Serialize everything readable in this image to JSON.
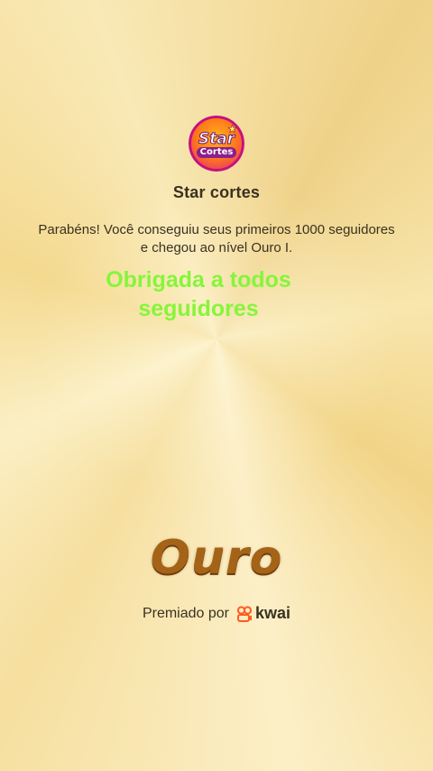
{
  "channel": {
    "logo_line1": "Star",
    "logo_line2": "Cortes",
    "name": "Star cortes"
  },
  "message": "Parabéns! Você conseguiu seus primeiros 1000 seguidores e chegou ao nível Ouro I.",
  "overlay_caption": "Obrigada a todos seguidores",
  "level": "Ouro",
  "award": {
    "label": "Premiado por",
    "brand": "kwai",
    "brand_icon": "kwai-logo-icon"
  },
  "colors": {
    "caption": "#86f53a",
    "level": "#a56318",
    "brand": "#ff5a1f",
    "text": "#3a3120"
  }
}
